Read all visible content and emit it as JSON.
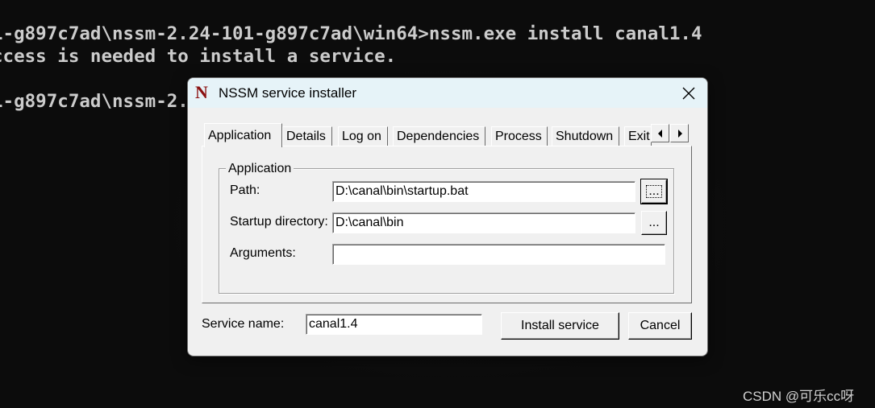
{
  "terminal": {
    "line1": "1-g897c7ad\\nssm-2.24-101-g897c7ad\\win64>nssm.exe install canal1.4",
    "line2": "ccess is needed to install a service.",
    "line3": "1-g897c7ad\\nssm-2."
  },
  "window": {
    "logo_letter": "N",
    "title": "NSSM service installer",
    "close_glyph": "✕"
  },
  "tabs": [
    {
      "label": "Application"
    },
    {
      "label": "Details"
    },
    {
      "label": "Log on"
    },
    {
      "label": "Dependencies"
    },
    {
      "label": "Process"
    },
    {
      "label": "Shutdown"
    },
    {
      "label": "Exit"
    }
  ],
  "tab_scroll": {
    "left": "◀",
    "right": "▶"
  },
  "application_group": {
    "title": "Application",
    "path_label": "Path:",
    "path_value": "D:\\canal\\bin\\startup.bat",
    "startup_dir_label": "Startup directory:",
    "startup_dir_value": "D:\\canal\\bin",
    "arguments_label": "Arguments:",
    "arguments_value": "",
    "browse_label": "..."
  },
  "footer": {
    "service_name_label": "Service name:",
    "service_name_value": "canal1.4",
    "install_label": "Install service",
    "cancel_label": "Cancel"
  },
  "watermark": "CSDN @可乐cc呀"
}
